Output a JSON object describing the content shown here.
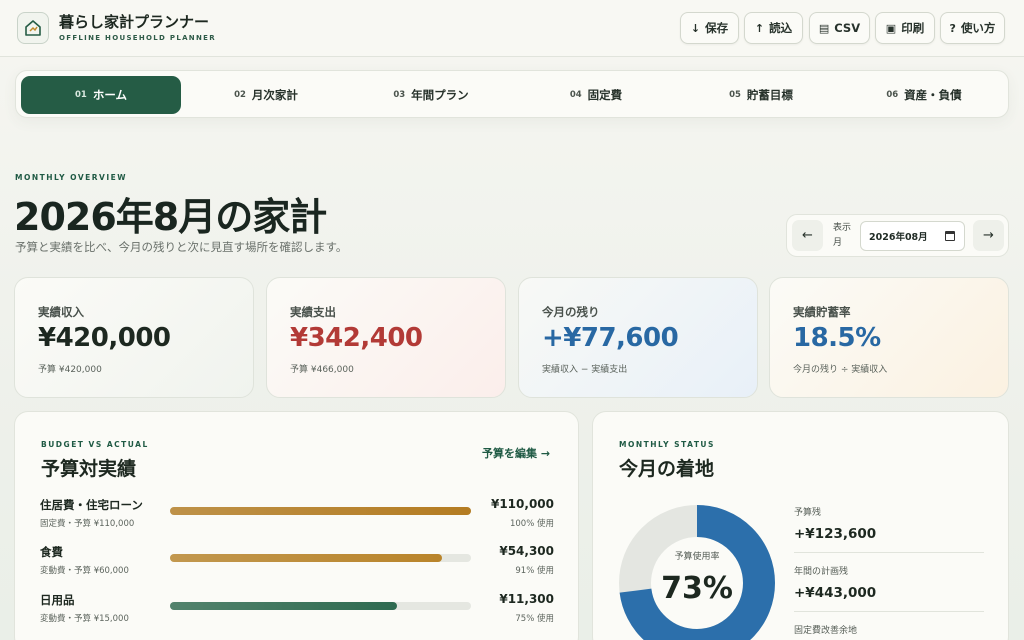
{
  "app": {
    "title": "暮らし家計プランナー",
    "subtitle": "OFFLINE HOUSEHOLD PLANNER",
    "logo_icon": "house-plan-icon"
  },
  "header_buttons": [
    {
      "icon": "↓",
      "icon_name": "download-icon",
      "label": "保存"
    },
    {
      "icon": "↑",
      "icon_name": "upload-icon",
      "label": "読込"
    },
    {
      "icon": "▤",
      "icon_name": "table-icon",
      "label": "CSV"
    },
    {
      "icon": "▣",
      "icon_name": "print-icon",
      "label": "印刷"
    },
    {
      "icon": "?",
      "icon_name": "help-icon",
      "label": "使い方"
    }
  ],
  "tabs": [
    {
      "num": "01",
      "label": "ホーム",
      "active": true
    },
    {
      "num": "02",
      "label": "月次家計",
      "active": false
    },
    {
      "num": "03",
      "label": "年間プラン",
      "active": false
    },
    {
      "num": "04",
      "label": "固定費",
      "active": false
    },
    {
      "num": "05",
      "label": "貯蓄目標",
      "active": false
    },
    {
      "num": "06",
      "label": "資産・負債",
      "active": false
    }
  ],
  "overview": {
    "eyebrow": "MONTHLY OVERVIEW",
    "title": "2026年8月の家計",
    "description": "予算と実績を比べ、今月の残りと次に見直す場所を確認します。"
  },
  "date_picker": {
    "label": "表示月",
    "value": "2026年08月",
    "prev_icon": "←",
    "next_icon": "→"
  },
  "summary_cards": [
    {
      "label": "実績収入",
      "value": "¥420,000",
      "sub": "予算 ¥420,000",
      "color": "#1d2820"
    },
    {
      "label": "実績支出",
      "value": "¥342,400",
      "sub": "予算 ¥466,000",
      "color": "#b23a36"
    },
    {
      "label": "今月の残り",
      "value": "+¥77,600",
      "sub": "実績収入 − 実績支出",
      "color": "#2868a3"
    },
    {
      "label": "実績貯蓄率",
      "value": "18.5%",
      "sub": "今月の残り ÷ 実績収入",
      "color": "#2868a3"
    }
  ],
  "budget": {
    "eyebrow": "BUDGET VS ACTUAL",
    "title": "予算対実績",
    "edit_link": "予算を編集 →",
    "rows": [
      {
        "name": "住居費・住宅ローン",
        "sub": "固定費・予算 ¥110,000",
        "amount": "¥110,000",
        "pct_label": "100% 使用",
        "ratio": 1.0,
        "color": "#b47c22"
      },
      {
        "name": "食費",
        "sub": "変動費・予算 ¥60,000",
        "amount": "¥54,300",
        "pct_label": "91% 使用",
        "ratio": 0.905,
        "color": "#b9842a"
      },
      {
        "name": "日用品",
        "sub": "変動費・予算 ¥15,000",
        "amount": "¥11,300",
        "pct_label": "75% 使用",
        "ratio": 0.753,
        "color": "#2e6a50"
      }
    ]
  },
  "status": {
    "eyebrow": "MONTHLY STATUS",
    "title": "今月の着地",
    "donut_label": "予算使用率",
    "donut_value": "73%",
    "ratio": 0.73,
    "used_color": "#2c6fab",
    "rest_color": "#e4e6e1",
    "stats": [
      {
        "label": "予算残",
        "value": "+¥123,600"
      },
      {
        "label": "年間の計画残",
        "value": "+¥443,000"
      },
      {
        "label": "固定費改善余地",
        "value": ""
      }
    ]
  }
}
